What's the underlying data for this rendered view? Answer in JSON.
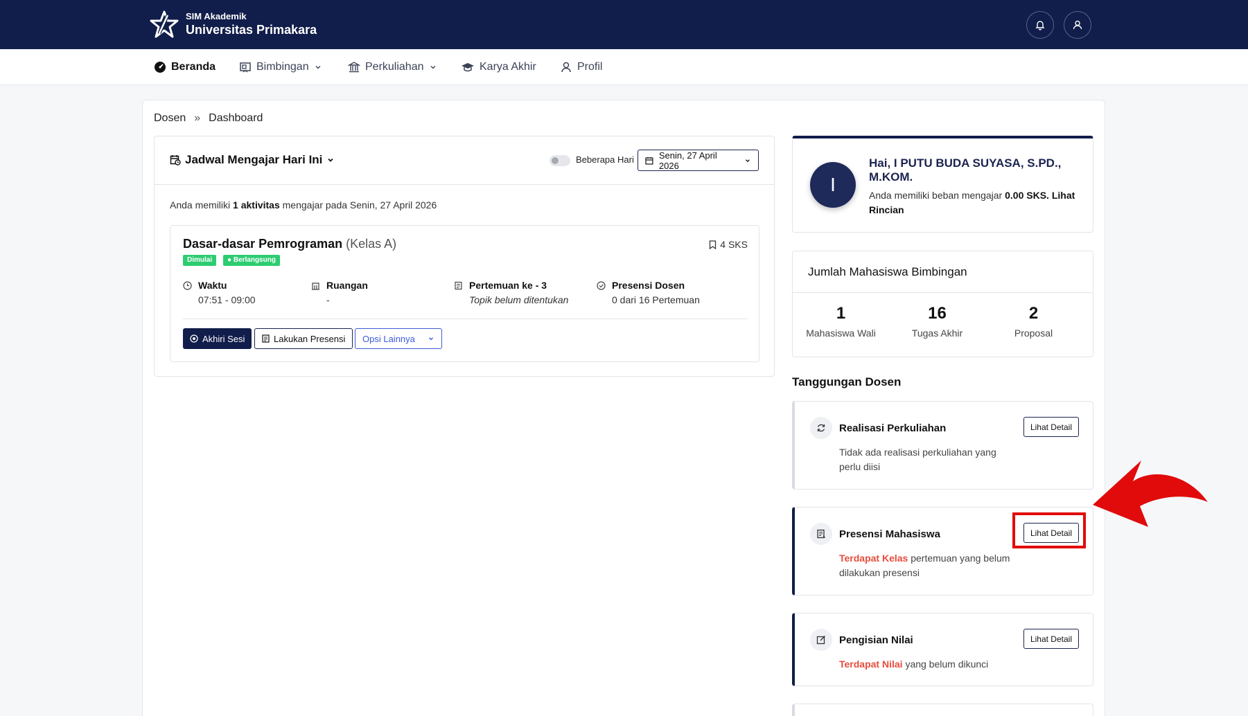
{
  "header": {
    "app_subtitle": "SIM Akademik",
    "app_name": "Universitas Primakara"
  },
  "nav": {
    "items": [
      {
        "label": "Beranda",
        "icon": "dashboard-icon",
        "active": true
      },
      {
        "label": "Bimbingan",
        "icon": "board-icon",
        "dropdown": true
      },
      {
        "label": "Perkuliahan",
        "icon": "university-icon",
        "dropdown": true
      },
      {
        "label": "Karya Akhir",
        "icon": "graduation-cap-icon"
      },
      {
        "label": "Profil",
        "icon": "user-icon"
      }
    ]
  },
  "breadcrumb": {
    "root": "Dosen",
    "separator": "»",
    "current": "Dashboard"
  },
  "schedule": {
    "title": "Jadwal Mengajar Hari Ini",
    "toggle_label": "Beberapa Hari",
    "date_value": "Senin, 27 April 2026",
    "info_prefix": "Anda memiliki",
    "info_count": "1 aktivitas",
    "info_suffix": "mengajar pada Senin, 27 April 2026",
    "class": {
      "name": "Dasar-dasar Pemrograman",
      "section": "(Kelas A)",
      "sks": "4 SKS",
      "badge_started": "Dimulai",
      "badge_ongoing": "● Berlangsung",
      "time_label": "Waktu",
      "time_value": "07:51 - 09:00",
      "room_label": "Ruangan",
      "room_value": "-",
      "meeting_label": "Pertemuan ke - 3",
      "meeting_value": "Topik belum ditentukan",
      "attendance_label": "Presensi Dosen",
      "attendance_value": "0 dari 16 Pertemuan",
      "btn_end": "Akhiri Sesi",
      "btn_presence": "Lakukan Presensi",
      "btn_more": "Opsi Lainnya"
    }
  },
  "greeting": {
    "avatar_letter": "I",
    "title": "Hai, I PUTU BUDA SUYASA, S.PD., M.KOM.",
    "text_prefix": "Anda memiliki beban mengajar",
    "sks_value": "0.00 SKS.",
    "link": "Lihat Rincian"
  },
  "students": {
    "title": "Jumlah Mahasiswa Bimbingan",
    "cells": [
      {
        "value": "1",
        "label": "Mahasiswa Wali"
      },
      {
        "value": "16",
        "label": "Tugas Akhir"
      },
      {
        "value": "2",
        "label": "Proposal"
      }
    ]
  },
  "responsibilities": {
    "title": "Tanggungan Dosen",
    "detail_label": "Lihat Detail",
    "items": [
      {
        "title": "Realisasi Perkuliahan",
        "highlight": "",
        "text": "Tidak ada realisasi perkuliahan yang perlu diisi",
        "icon": "refresh-icon"
      },
      {
        "title": "Presensi Mahasiswa",
        "highlight": "Terdapat Kelas",
        "text": "pertemuan yang belum dilakukan presensi",
        "icon": "document-icon"
      },
      {
        "title": "Pengisian Nilai",
        "highlight": "Terdapat Nilai",
        "text": "yang belum dikunci",
        "icon": "edit-icon"
      }
    ]
  },
  "colors": {
    "primary": "#111d4a",
    "success": "#2ecc71",
    "danger": "#e74c3c",
    "annotation": "#e10b0b"
  }
}
